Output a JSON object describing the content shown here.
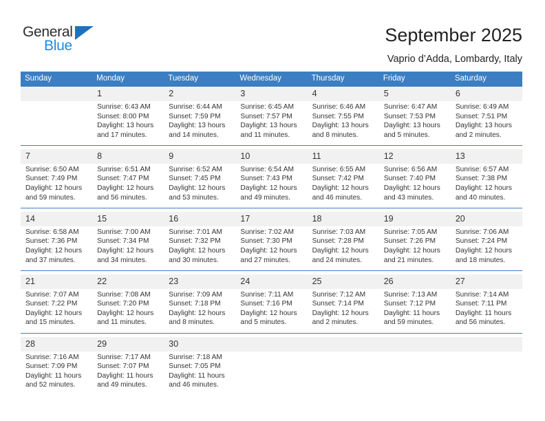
{
  "brand": {
    "name_top": "General",
    "name_bottom": "Blue",
    "accent_color": "#1c8ae0",
    "triangle_color": "#1c72c0"
  },
  "header": {
    "title": "September 2025",
    "subtitle": "Vaprio d’Adda, Lombardy, Italy"
  },
  "calendar": {
    "header_bg": "#3b7ec1",
    "header_text_color": "#ffffff",
    "daynum_bg": "#f1f1f1",
    "weekday_headers": [
      "Sunday",
      "Monday",
      "Tuesday",
      "Wednesday",
      "Thursday",
      "Friday",
      "Saturday"
    ],
    "weeks": [
      {
        "days": [
          {
            "num": "",
            "sunrise": "",
            "sunset": "",
            "daylight1": "",
            "daylight2": ""
          },
          {
            "num": "1",
            "sunrise": "Sunrise: 6:43 AM",
            "sunset": "Sunset: 8:00 PM",
            "daylight1": "Daylight: 13 hours",
            "daylight2": "and 17 minutes."
          },
          {
            "num": "2",
            "sunrise": "Sunrise: 6:44 AM",
            "sunset": "Sunset: 7:59 PM",
            "daylight1": "Daylight: 13 hours",
            "daylight2": "and 14 minutes."
          },
          {
            "num": "3",
            "sunrise": "Sunrise: 6:45 AM",
            "sunset": "Sunset: 7:57 PM",
            "daylight1": "Daylight: 13 hours",
            "daylight2": "and 11 minutes."
          },
          {
            "num": "4",
            "sunrise": "Sunrise: 6:46 AM",
            "sunset": "Sunset: 7:55 PM",
            "daylight1": "Daylight: 13 hours",
            "daylight2": "and 8 minutes."
          },
          {
            "num": "5",
            "sunrise": "Sunrise: 6:47 AM",
            "sunset": "Sunset: 7:53 PM",
            "daylight1": "Daylight: 13 hours",
            "daylight2": "and 5 minutes."
          },
          {
            "num": "6",
            "sunrise": "Sunrise: 6:49 AM",
            "sunset": "Sunset: 7:51 PM",
            "daylight1": "Daylight: 13 hours",
            "daylight2": "and 2 minutes."
          }
        ]
      },
      {
        "days": [
          {
            "num": "7",
            "sunrise": "Sunrise: 6:50 AM",
            "sunset": "Sunset: 7:49 PM",
            "daylight1": "Daylight: 12 hours",
            "daylight2": "and 59 minutes."
          },
          {
            "num": "8",
            "sunrise": "Sunrise: 6:51 AM",
            "sunset": "Sunset: 7:47 PM",
            "daylight1": "Daylight: 12 hours",
            "daylight2": "and 56 minutes."
          },
          {
            "num": "9",
            "sunrise": "Sunrise: 6:52 AM",
            "sunset": "Sunset: 7:45 PM",
            "daylight1": "Daylight: 12 hours",
            "daylight2": "and 53 minutes."
          },
          {
            "num": "10",
            "sunrise": "Sunrise: 6:54 AM",
            "sunset": "Sunset: 7:43 PM",
            "daylight1": "Daylight: 12 hours",
            "daylight2": "and 49 minutes."
          },
          {
            "num": "11",
            "sunrise": "Sunrise: 6:55 AM",
            "sunset": "Sunset: 7:42 PM",
            "daylight1": "Daylight: 12 hours",
            "daylight2": "and 46 minutes."
          },
          {
            "num": "12",
            "sunrise": "Sunrise: 6:56 AM",
            "sunset": "Sunset: 7:40 PM",
            "daylight1": "Daylight: 12 hours",
            "daylight2": "and 43 minutes."
          },
          {
            "num": "13",
            "sunrise": "Sunrise: 6:57 AM",
            "sunset": "Sunset: 7:38 PM",
            "daylight1": "Daylight: 12 hours",
            "daylight2": "and 40 minutes."
          }
        ]
      },
      {
        "days": [
          {
            "num": "14",
            "sunrise": "Sunrise: 6:58 AM",
            "sunset": "Sunset: 7:36 PM",
            "daylight1": "Daylight: 12 hours",
            "daylight2": "and 37 minutes."
          },
          {
            "num": "15",
            "sunrise": "Sunrise: 7:00 AM",
            "sunset": "Sunset: 7:34 PM",
            "daylight1": "Daylight: 12 hours",
            "daylight2": "and 34 minutes."
          },
          {
            "num": "16",
            "sunrise": "Sunrise: 7:01 AM",
            "sunset": "Sunset: 7:32 PM",
            "daylight1": "Daylight: 12 hours",
            "daylight2": "and 30 minutes."
          },
          {
            "num": "17",
            "sunrise": "Sunrise: 7:02 AM",
            "sunset": "Sunset: 7:30 PM",
            "daylight1": "Daylight: 12 hours",
            "daylight2": "and 27 minutes."
          },
          {
            "num": "18",
            "sunrise": "Sunrise: 7:03 AM",
            "sunset": "Sunset: 7:28 PM",
            "daylight1": "Daylight: 12 hours",
            "daylight2": "and 24 minutes."
          },
          {
            "num": "19",
            "sunrise": "Sunrise: 7:05 AM",
            "sunset": "Sunset: 7:26 PM",
            "daylight1": "Daylight: 12 hours",
            "daylight2": "and 21 minutes."
          },
          {
            "num": "20",
            "sunrise": "Sunrise: 7:06 AM",
            "sunset": "Sunset: 7:24 PM",
            "daylight1": "Daylight: 12 hours",
            "daylight2": "and 18 minutes."
          }
        ]
      },
      {
        "days": [
          {
            "num": "21",
            "sunrise": "Sunrise: 7:07 AM",
            "sunset": "Sunset: 7:22 PM",
            "daylight1": "Daylight: 12 hours",
            "daylight2": "and 15 minutes."
          },
          {
            "num": "22",
            "sunrise": "Sunrise: 7:08 AM",
            "sunset": "Sunset: 7:20 PM",
            "daylight1": "Daylight: 12 hours",
            "daylight2": "and 11 minutes."
          },
          {
            "num": "23",
            "sunrise": "Sunrise: 7:09 AM",
            "sunset": "Sunset: 7:18 PM",
            "daylight1": "Daylight: 12 hours",
            "daylight2": "and 8 minutes."
          },
          {
            "num": "24",
            "sunrise": "Sunrise: 7:11 AM",
            "sunset": "Sunset: 7:16 PM",
            "daylight1": "Daylight: 12 hours",
            "daylight2": "and 5 minutes."
          },
          {
            "num": "25",
            "sunrise": "Sunrise: 7:12 AM",
            "sunset": "Sunset: 7:14 PM",
            "daylight1": "Daylight: 12 hours",
            "daylight2": "and 2 minutes."
          },
          {
            "num": "26",
            "sunrise": "Sunrise: 7:13 AM",
            "sunset": "Sunset: 7:12 PM",
            "daylight1": "Daylight: 11 hours",
            "daylight2": "and 59 minutes."
          },
          {
            "num": "27",
            "sunrise": "Sunrise: 7:14 AM",
            "sunset": "Sunset: 7:11 PM",
            "daylight1": "Daylight: 11 hours",
            "daylight2": "and 56 minutes."
          }
        ]
      },
      {
        "days": [
          {
            "num": "28",
            "sunrise": "Sunrise: 7:16 AM",
            "sunset": "Sunset: 7:09 PM",
            "daylight1": "Daylight: 11 hours",
            "daylight2": "and 52 minutes."
          },
          {
            "num": "29",
            "sunrise": "Sunrise: 7:17 AM",
            "sunset": "Sunset: 7:07 PM",
            "daylight1": "Daylight: 11 hours",
            "daylight2": "and 49 minutes."
          },
          {
            "num": "30",
            "sunrise": "Sunrise: 7:18 AM",
            "sunset": "Sunset: 7:05 PM",
            "daylight1": "Daylight: 11 hours",
            "daylight2": "and 46 minutes."
          },
          {
            "num": "",
            "sunrise": "",
            "sunset": "",
            "daylight1": "",
            "daylight2": ""
          },
          {
            "num": "",
            "sunrise": "",
            "sunset": "",
            "daylight1": "",
            "daylight2": ""
          },
          {
            "num": "",
            "sunrise": "",
            "sunset": "",
            "daylight1": "",
            "daylight2": ""
          },
          {
            "num": "",
            "sunrise": "",
            "sunset": "",
            "daylight1": "",
            "daylight2": ""
          }
        ]
      }
    ]
  }
}
